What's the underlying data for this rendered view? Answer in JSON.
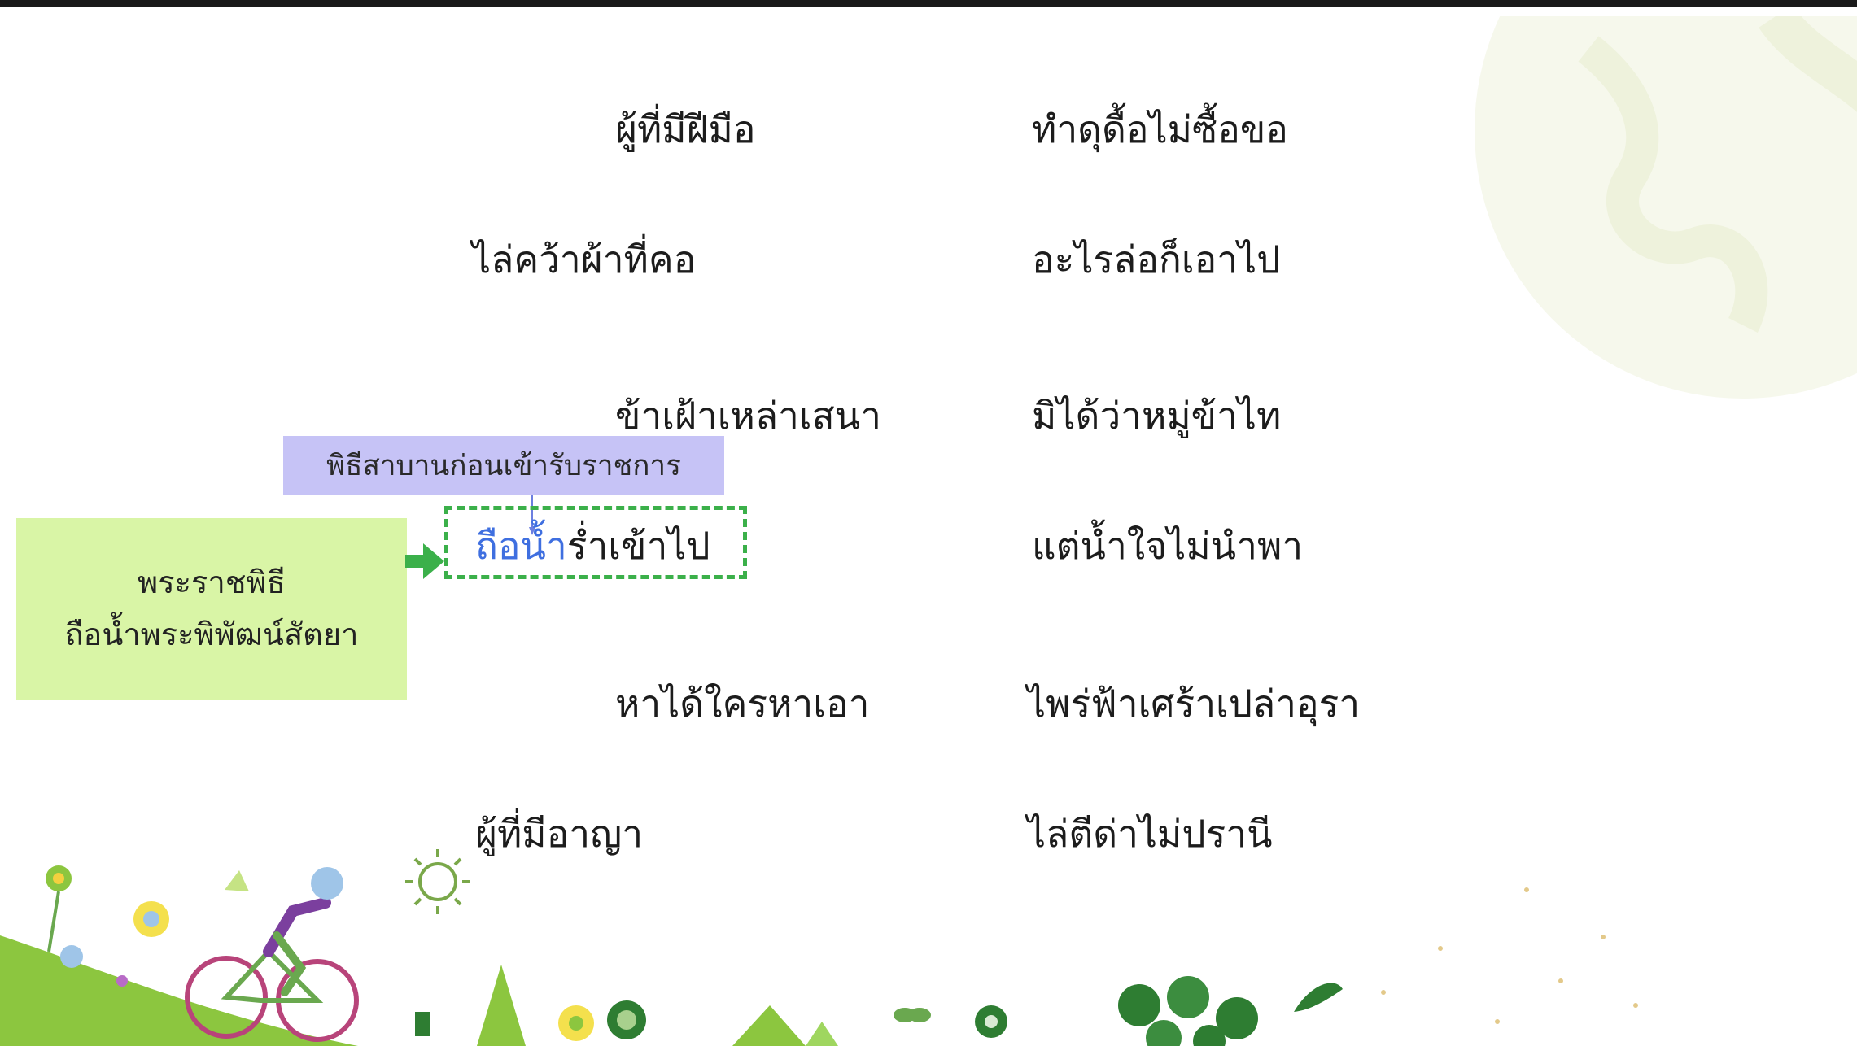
{
  "poem": {
    "left_column": [
      "ผู้ที่มีฝีมือ",
      "ไล่คว้าผ้าที่คอ",
      "ข้าเฝ้าเหล่าเสนา",
      "ถือน้ำร่ำเข้าไป",
      "หาได้ใครหาเอา",
      "ผู้ที่มีอาญา"
    ],
    "right_column": [
      "ทำดุดื้อไม่ซื้อขอ",
      "อะไรล่อก็เอาไป",
      "มิได้ว่าหมู่ข้าไท",
      "แต่น้ำใจไม่นำพา",
      "ไพร่ฟ้าเศร้าเปล่าอุรา",
      "ไล่ตีด่าไม่ปรานี"
    ]
  },
  "highlight": {
    "word": "ถือน้ำ",
    "rest": "ร่ำเข้าไป",
    "word_color": "#3f6fe0",
    "frame_color": "#3bb04a"
  },
  "note": {
    "text": "พิธีสาบานก่อนเข้ารับราชการ",
    "color": "#c6c3f6"
  },
  "ceremony": {
    "line1": "พระราชพิธี",
    "line2": "ถือน้ำพระพิพัฒน์สัตยา",
    "color": "#d9f5a6",
    "arrow_color": "#3bb04a"
  },
  "decorations": {
    "icons": [
      "globe-watermark",
      "flower-icon",
      "cyclist-icon",
      "sun-icon",
      "tree-icon",
      "butterfly-icon",
      "grass-hill"
    ],
    "accent": "#8cc63f"
  }
}
